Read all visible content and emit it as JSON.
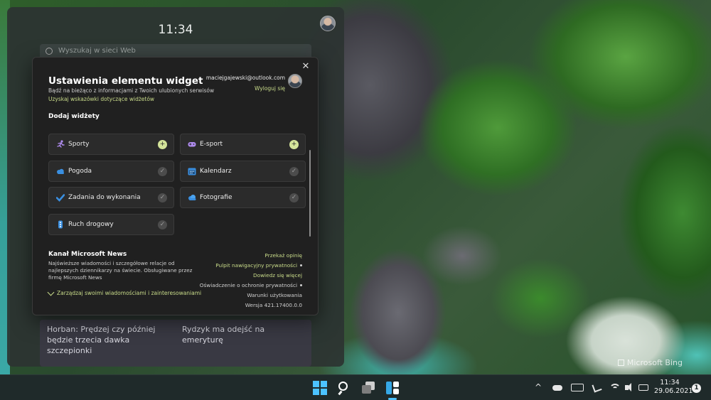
{
  "wallpaper": {
    "watermark": "Microsoft Bing"
  },
  "widget_board": {
    "time": "11:34",
    "search_placeholder": "Wyszukaj w sieci Web",
    "news_cards": [
      "Horban: Prędzej czy później będzie trzecia dawka szczepionki",
      "Rydzyk ma odejść na emeryturę"
    ]
  },
  "dialog": {
    "title": "Ustawienia elementu widget",
    "subtitle": "Bądź na bieżąco z informacjami z Twoich ulubionych serwisów",
    "tips_link": "Uzyskaj wskazówki dotyczące widżetów",
    "account_email": "maciejgajewski@outlook.com",
    "sign_out": "Wyloguj się",
    "close_glyph": "✕",
    "add_section_title": "Dodaj widżety",
    "widgets": [
      {
        "label": "Sporty",
        "icon": "sports-icon",
        "state": "add",
        "state_glyph": "+"
      },
      {
        "label": "E-sport",
        "icon": "esports-icon",
        "state": "add",
        "state_glyph": "+"
      },
      {
        "label": "Pogoda",
        "icon": "weather-icon",
        "state": "added",
        "state_glyph": "✓"
      },
      {
        "label": "Kalendarz",
        "icon": "calendar-icon",
        "state": "added",
        "state_glyph": "✓"
      },
      {
        "label": "Zadania do wykonania",
        "icon": "todo-icon",
        "state": "added",
        "state_glyph": "✓"
      },
      {
        "label": "Fotografie",
        "icon": "photos-icon",
        "state": "added",
        "state_glyph": "✓"
      },
      {
        "label": "Ruch drogowy",
        "icon": "traffic-icon",
        "state": "added",
        "state_glyph": "✓"
      }
    ],
    "feed": {
      "title": "Kanał Microsoft News",
      "description": "Najświeższe wiadomości i szczegółowe relacje od najlepszych dziennikarzy na świecie. Obsługiwane przez firmę Microsoft News",
      "manage_link": "Zarządzaj swoimi wiadomościami i zainteresowaniami"
    },
    "links": {
      "feedback": "Przekaż opinię",
      "privacy_dashboard": "Pulpit nawigacyjny prywatności",
      "learn_more": "Dowiedz się więcej",
      "privacy_statement": "Oświadczenie o ochronie prywatności",
      "terms": "Warunki użytkowania",
      "version": "Wersja 421.17400.0.0"
    }
  },
  "taskbar": {
    "clock_time": "11:34",
    "clock_date": "29.06.2021",
    "notification_count": "1",
    "tray_chevron": "^"
  },
  "colors": {
    "accent_link": "#c9dc8a",
    "add_button": "#d4e49a",
    "start_blue": "#4cc2ff"
  }
}
